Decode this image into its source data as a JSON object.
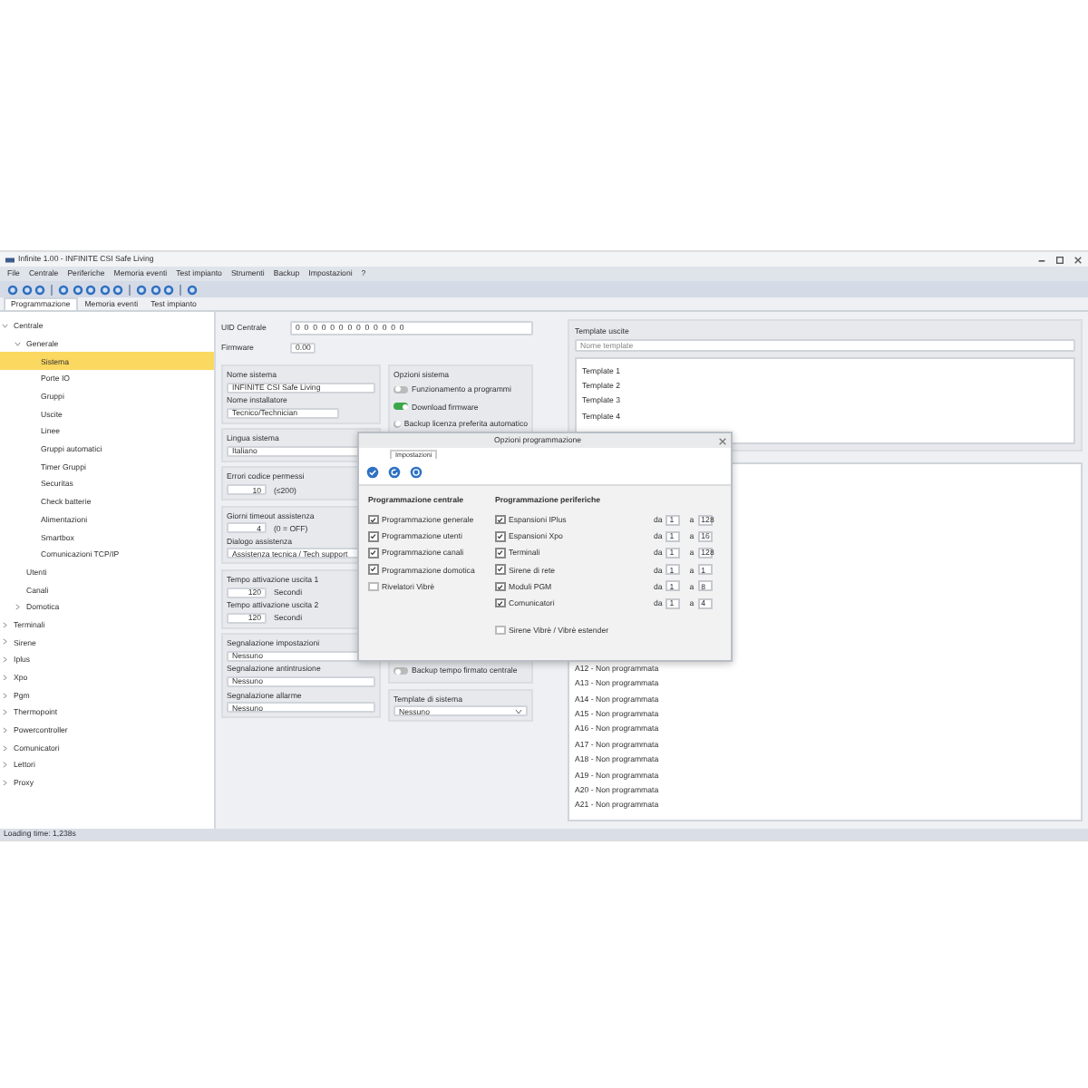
{
  "window": {
    "title": "Infinite 1.00 - INFINITE CSI Safe Living"
  },
  "menu": [
    "File",
    "Centrale",
    "Periferiche",
    "Memoria eventi",
    "Test impianto",
    "Strumenti",
    "Backup",
    "Impostazioni",
    "?"
  ],
  "tabs": [
    {
      "label": "Programmazione",
      "selected": true
    },
    {
      "label": "Memoria eventi",
      "selected": false
    },
    {
      "label": "Test impianto",
      "selected": false
    }
  ],
  "tree": [
    {
      "label": "Centrale",
      "expanded": true,
      "selected": false,
      "children": [
        {
          "label": "Generale",
          "expanded": true,
          "selected": false,
          "children": [
            {
              "label": "Sistema",
              "selected": true
            },
            {
              "label": "Porte IO",
              "selected": false
            },
            {
              "label": "Gruppi",
              "selected": false
            },
            {
              "label": "Uscite",
              "selected": false
            },
            {
              "label": "Linee",
              "selected": false
            },
            {
              "label": "Gruppi automatici",
              "selected": false
            },
            {
              "label": "Timer Gruppi",
              "selected": false
            },
            {
              "label": "Securitas",
              "selected": false
            },
            {
              "label": "Check batterie",
              "selected": false
            },
            {
              "label": "Alimentazioni",
              "selected": false
            },
            {
              "label": "Smartbox",
              "selected": false
            },
            {
              "label": "Comunicazioni TCP/IP",
              "selected": false
            }
          ]
        },
        {
          "label": "Utenti",
          "selected": false
        },
        {
          "label": "Canali",
          "selected": false
        },
        {
          "label": "Domotica",
          "expanded": false,
          "selected": false
        }
      ]
    },
    {
      "label": "Terminali",
      "expanded": false,
      "selected": false
    },
    {
      "label": "Sirene",
      "expanded": false,
      "selected": false
    },
    {
      "label": "Iplus",
      "expanded": false,
      "selected": false
    },
    {
      "label": "Xpo",
      "expanded": false,
      "selected": false
    },
    {
      "label": "Pgm",
      "expanded": false,
      "selected": false
    },
    {
      "label": "Thermopoint",
      "expanded": false,
      "selected": false
    },
    {
      "label": "Powercontroller",
      "expanded": false,
      "selected": false
    },
    {
      "label": "Comunicatori",
      "expanded": false,
      "selected": false
    },
    {
      "label": "Lettori",
      "expanded": false,
      "selected": false
    },
    {
      "label": "Proxy",
      "expanded": false,
      "selected": false
    }
  ],
  "system": {
    "uid_label": "UID Centrale",
    "uid": "0 0 0 0 0 0 0 0 0 0 0 0 0",
    "firmware_label": "Firmware",
    "firmware": "0.00",
    "name_label": "Nome sistema",
    "name": "INFINITE CSI Safe Living",
    "installer_label": "Nome installatore",
    "installer": "Tecnico/Technician",
    "language_label": "Lingua sistema",
    "language": "Italiano",
    "code_errors_label": "Errori codice permessi",
    "code_errors": "10",
    "code_errors_range": "(≤200)",
    "timeout_label": "Giorni timeout assistenza",
    "timeout": "4",
    "timeout_range": "(0 = OFF)",
    "assist_label": "Dialogo assistenza",
    "assist": "Assistenza tecnica / Tech support",
    "outputs": [
      {
        "label": "Tempo attivazione uscita 1",
        "value": "120",
        "unit": "Secondi"
      },
      {
        "label": "Tempo attivazione uscita 2",
        "value": "120",
        "unit": "Secondi"
      }
    ],
    "signals": [
      {
        "label": "Segnalazione impostazioni",
        "value": "Nessuno"
      },
      {
        "label": "Segnalazione antintrusione",
        "value": "Nessuno"
      },
      {
        "label": "Segnalazione allarme",
        "value": "Nessuno"
      }
    ]
  },
  "options": {
    "title": "Opzioni sistema",
    "toggles": [
      {
        "label": "Funzionamento a programmi",
        "on": false
      },
      {
        "label": "Download firmware",
        "on": true
      },
      {
        "label": "Backup licenza preferita automatico",
        "on": false
      }
    ],
    "late_toggle": {
      "label": "Backup tempo firmato centrale",
      "on": false
    },
    "template_label": "Template di sistema",
    "template": "Nessuno"
  },
  "templates": {
    "title": "Template uscite",
    "placeholder": "Nome template",
    "items": [
      "Template 1",
      "Template 2",
      "Template 3",
      "Template 4"
    ]
  },
  "zones": [
    "A12 - Non programmata",
    "A13 - Non programmata",
    "A14 - Non programmata",
    "A15 - Non programmata",
    "A16 - Non programmata",
    "A17 - Non programmata",
    "A18 - Non programmata",
    "A19 - Non programmata",
    "A20 - Non programmata",
    "A21 - Non programmata"
  ],
  "dialog": {
    "title": "Opzioni programmazione",
    "tab": "Impostazioni",
    "central_title": "Programmazione centrale",
    "central": [
      {
        "label": "Programmazione generale",
        "checked": true
      },
      {
        "label": "Programmazione utenti",
        "checked": true
      },
      {
        "label": "Programmazione canali",
        "checked": true
      },
      {
        "label": "Programmazione domotica",
        "checked": true
      },
      {
        "label": "Rivelatori Vibrè",
        "checked": false
      }
    ],
    "periph_title": "Programmazione periferiche",
    "periph": [
      {
        "label": "Espansioni IPlus",
        "checked": true,
        "from_label": "da",
        "from": "1",
        "to_label": "a",
        "to": "128"
      },
      {
        "label": "Espansioni Xpo",
        "checked": true,
        "from_label": "da",
        "from": "1",
        "to_label": "a",
        "to": "16"
      },
      {
        "label": "Terminali",
        "checked": true,
        "from_label": "da",
        "from": "1",
        "to_label": "a",
        "to": "128"
      },
      {
        "label": "Sirene di rete",
        "checked": true,
        "from_label": "da",
        "from": "1",
        "to_label": "a",
        "to": "1"
      },
      {
        "label": "Moduli PGM",
        "checked": true,
        "from_label": "da",
        "from": "1",
        "to_label": "a",
        "to": "8"
      },
      {
        "label": "Comunicatori",
        "checked": true,
        "from_label": "da",
        "from": "1",
        "to_label": "a",
        "to": "4"
      }
    ],
    "extra": {
      "label": "Sirene Vibrè / Vibrè estender",
      "checked": false
    }
  },
  "status_bar": "Loading time: 1,238s"
}
